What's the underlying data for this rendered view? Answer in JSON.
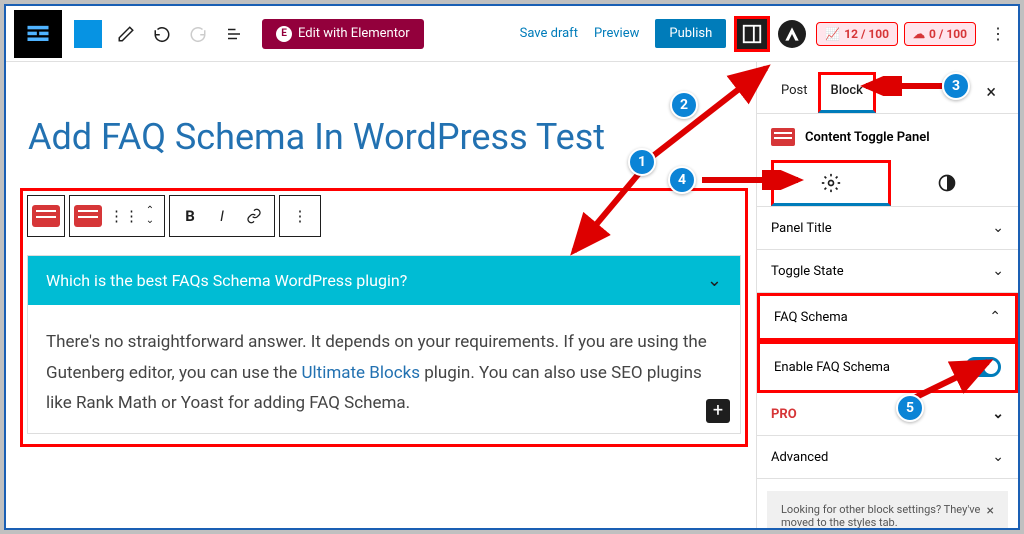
{
  "topbar": {
    "elementor_label": "Edit with Elementor",
    "save_draft": "Save draft",
    "preview": "Preview",
    "publish": "Publish",
    "score1": "12 / 100",
    "score2": "0 / 100"
  },
  "editor": {
    "title": "Add FAQ Schema In WordPress Test",
    "faq_question": "Which is the best FAQs Schema WordPress plugin?",
    "faq_answer_pre": "There's no straightforward answer. It depends on your requirements. If you are using the Gutenberg editor, you can use the ",
    "faq_answer_link": "Ultimate Blocks",
    "faq_answer_post": " plugin. You can also use SEO plugins like Rank Math or Yoast for adding FAQ Schema."
  },
  "sidebar": {
    "tab_post": "Post",
    "tab_block": "Block",
    "block_name": "Content Toggle Panel",
    "sections": {
      "panel_title": "Panel Title",
      "toggle_state": "Toggle State",
      "faq_schema": "FAQ Schema",
      "enable_faq": "Enable FAQ Schema",
      "pro": "PRO",
      "advanced": "Advanced"
    },
    "hint": "Looking for other block settings? They've moved to the styles tab."
  },
  "annotations": {
    "1": "1",
    "2": "2",
    "3": "3",
    "4": "4",
    "5": "5"
  }
}
